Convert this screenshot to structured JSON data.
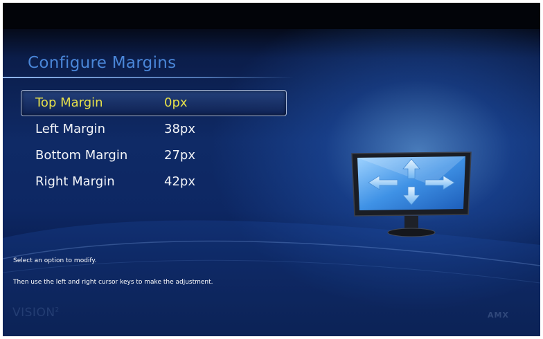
{
  "title": "Configure Margins",
  "menu": {
    "items": [
      {
        "label": "Top Margin",
        "value": "0px",
        "selected": true
      },
      {
        "label": "Left Margin",
        "value": "38px",
        "selected": false
      },
      {
        "label": "Bottom Margin",
        "value": "27px",
        "selected": false
      },
      {
        "label": "Right Margin",
        "value": "42px",
        "selected": false
      }
    ]
  },
  "help": {
    "line1": "Select an option to modify.",
    "line2": "Then use the left and right cursor keys to make the adjustment."
  },
  "branding": {
    "left": "VISION",
    "left_sup": "2",
    "right": "AMX"
  },
  "icons": {
    "monitor": "monitor-arrows-icon"
  },
  "colors": {
    "selected_text": "#e6e04a",
    "title": "#4a86d8",
    "text": "#f2f4f8"
  }
}
